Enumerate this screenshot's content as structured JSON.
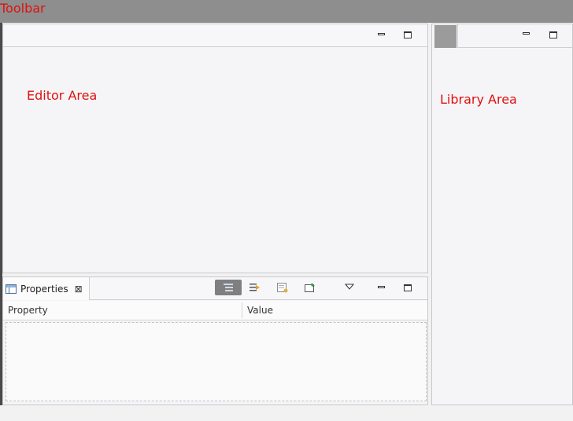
{
  "toolbar": {
    "label": "Toolbar"
  },
  "editor": {
    "label": "Editor Area"
  },
  "library": {
    "label": "Library Area"
  },
  "properties": {
    "tab_label": "Properties",
    "tab_close": "⊠",
    "columns": {
      "property": "Property",
      "value": "Value"
    },
    "tools": [
      "categories-icon",
      "filter-advanced-icon",
      "restore-defaults-icon",
      "pin-icon"
    ]
  },
  "icons": {
    "minimize": "minimize-icon",
    "maximize": "maximize-icon",
    "view_menu": "view-menu-icon"
  },
  "colors": {
    "annotation": "#e01010",
    "toolbar_bg": "#8e8e8e",
    "panel_bg": "#f5f5f7"
  }
}
